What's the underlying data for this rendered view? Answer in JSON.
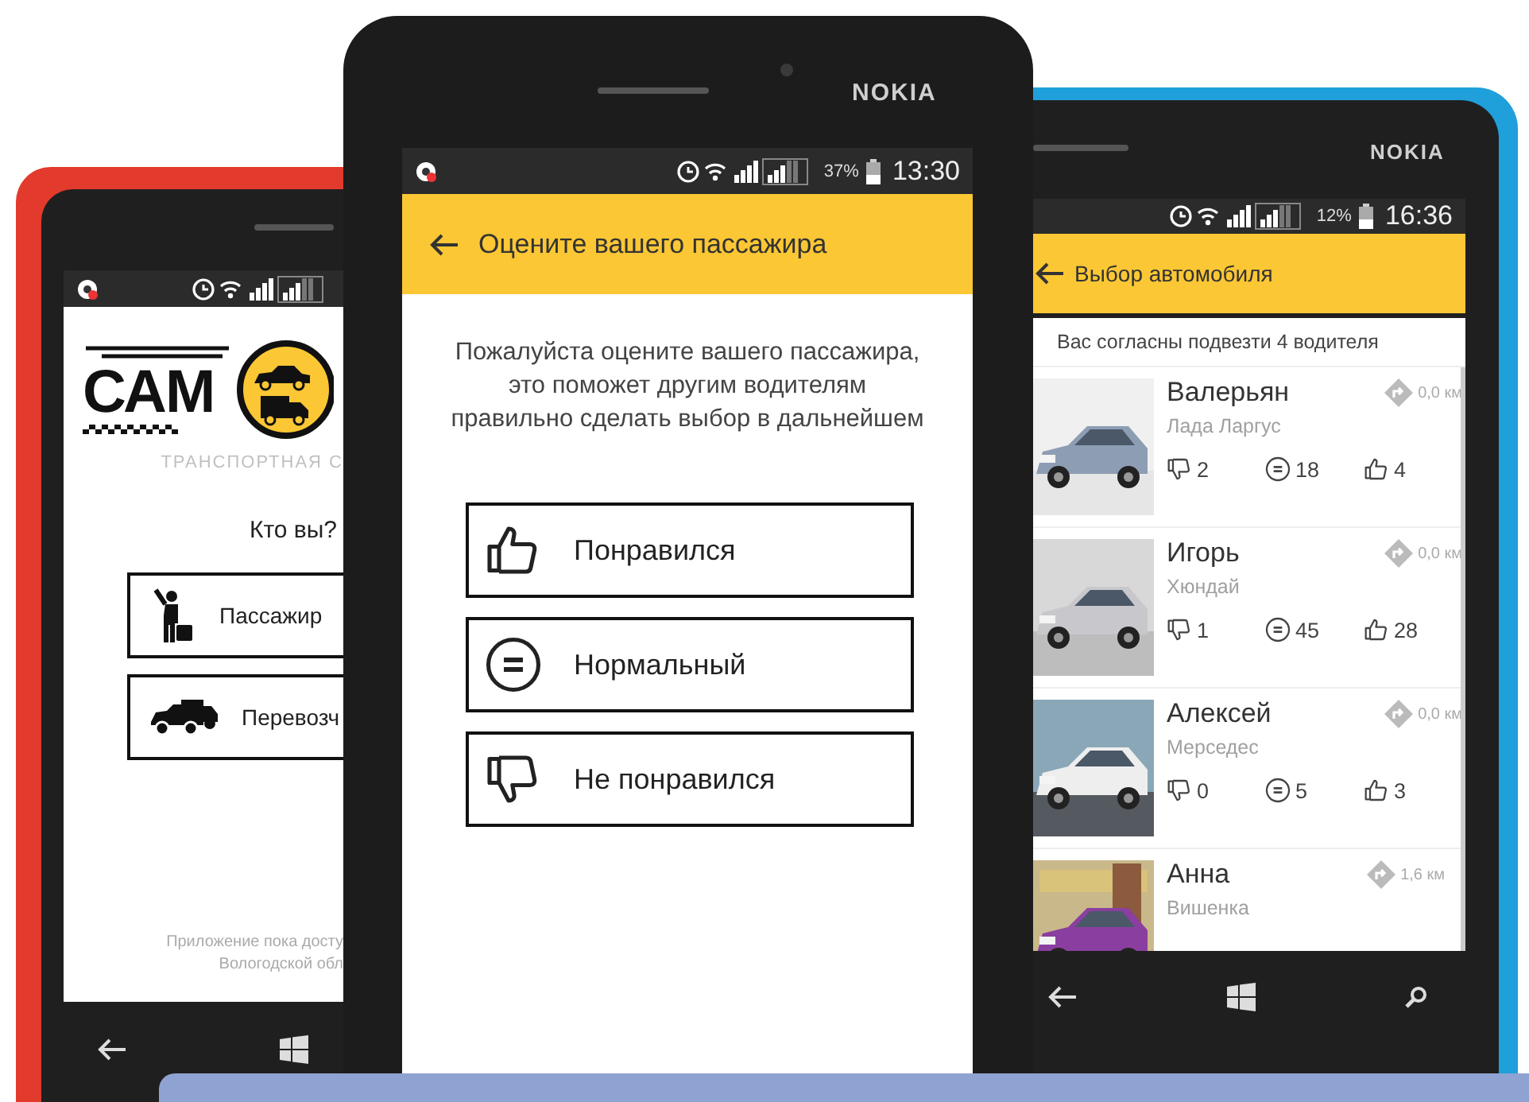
{
  "left_phone": {
    "status_bar": {
      "notification": true
    },
    "logo": {
      "text": "САМ",
      "subtitle": "ТРАНСПОРТНАЯ С"
    },
    "question": "Кто вы?",
    "options": [
      {
        "kind": "passenger",
        "label": "Пассажир"
      },
      {
        "kind": "carrier",
        "label": "Перевозч"
      }
    ],
    "footer": [
      "Приложение пока досту",
      "Вологодской обл"
    ]
  },
  "middle_phone": {
    "brand": "NOKIA",
    "status_bar": {
      "notification": true,
      "battery": "37%",
      "time": "13:30"
    },
    "header": {
      "title": "Оцените вашего пассажира"
    },
    "prompt": "Пожалуйста оцените вашего пассажира, это поможет другим водителям правильно сделать выбор в дальнейшем",
    "ratings": [
      {
        "kind": "like",
        "label": "Понравился"
      },
      {
        "kind": "neutral",
        "label": "Нормальный"
      },
      {
        "kind": "dislike",
        "label": "Не понравился"
      }
    ]
  },
  "right_phone": {
    "brand": "NOKIA",
    "status_bar": {
      "notification": false,
      "battery": "12%",
      "time": "16:36"
    },
    "header": {
      "title": "Выбор автомобиля"
    },
    "notice": "Вас согласны подвезти 4 водителя",
    "drivers": [
      {
        "name": "Валерьян",
        "car": "Лада Ларгус",
        "distance": "0,0 км",
        "dislikes": "2",
        "neutral": "18",
        "likes": "4"
      },
      {
        "name": "Игорь",
        "car": "Хюндай",
        "distance": "0,0 км",
        "dislikes": "1",
        "neutral": "45",
        "likes": "28"
      },
      {
        "name": "Алексей",
        "car": "Мерседес",
        "distance": "0,0 км",
        "dislikes": "0",
        "neutral": "5",
        "likes": "3"
      },
      {
        "name": "Анна",
        "car": "Вишенка",
        "distance": "1,6 км"
      }
    ]
  }
}
